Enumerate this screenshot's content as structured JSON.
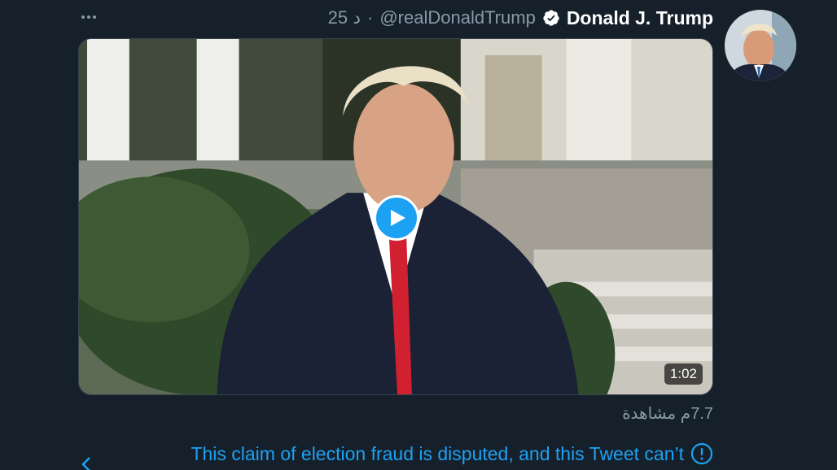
{
  "tweet": {
    "display_name": "Donald J. Trump",
    "handle": "@realDonaldTrump",
    "separator": "·",
    "time": "25 د",
    "verified_icon": "verified-badge-icon",
    "more_icon": "more-dots-icon",
    "avatar": "avatar-photo"
  },
  "media": {
    "type": "video",
    "duration": "1:02",
    "play_icon": "play-icon",
    "views": "7.7م مشاهدة"
  },
  "notice": {
    "text": "This claim of election fraud is disputed, and this Tweet can’t",
    "icon": "alert-circle-icon"
  },
  "colors": {
    "background": "#15202b",
    "accent": "#1da1f2",
    "secondary_text": "#8899a6",
    "primary_text": "#ffffff"
  }
}
